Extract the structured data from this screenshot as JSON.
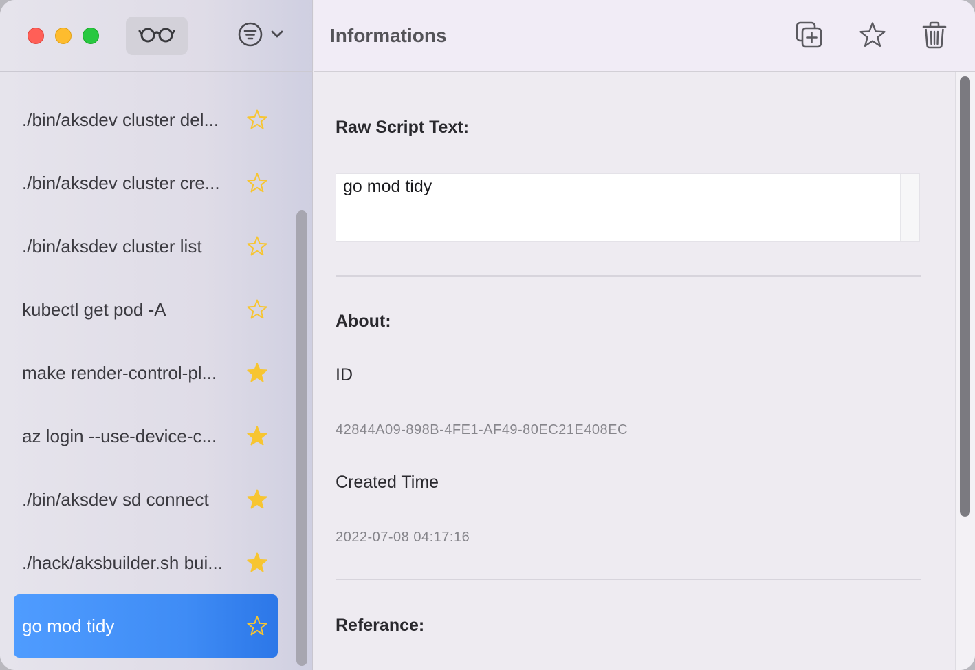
{
  "sidebar": {
    "items": [
      {
        "label": "./bin/aksdev cluster del...",
        "starred": false
      },
      {
        "label": "./bin/aksdev cluster cre...",
        "starred": false
      },
      {
        "label": "./bin/aksdev cluster list",
        "starred": false
      },
      {
        "label": "kubectl get pod -A",
        "starred": false
      },
      {
        "label": "make render-control-pl...",
        "starred": true
      },
      {
        "label": "az login --use-device-c...",
        "starred": true
      },
      {
        "label": "./bin/aksdev sd connect",
        "starred": true
      },
      {
        "label": "./hack/aksbuilder.sh bui...",
        "starred": true
      },
      {
        "label": "go mod tidy",
        "starred": false,
        "selected": true
      }
    ]
  },
  "header": {
    "title": "Informations"
  },
  "main": {
    "raw_script_title": "Raw Script Text:",
    "raw_script_text": "go mod tidy",
    "about_title": "About:",
    "id_label": "ID",
    "id_value": "42844A09-898B-4FE1-AF49-80EC21E408EC",
    "created_label": "Created Time",
    "created_value": "2022-07-08 04:17:16",
    "reference_title": "Referance:"
  },
  "colors": {
    "accent": "#3f8cf5",
    "star": "#f7c531"
  },
  "icons": {
    "toolbar": [
      "glasses-icon",
      "filter-icon",
      "chevron-down-icon"
    ],
    "actions": [
      "duplicate-icon",
      "star-icon",
      "trash-icon"
    ]
  }
}
